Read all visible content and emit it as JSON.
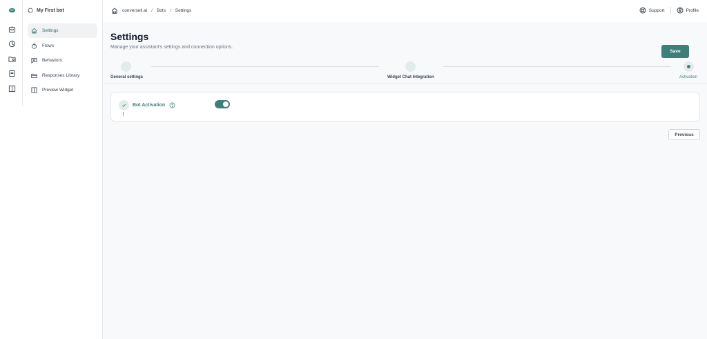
{
  "sidebar": {
    "bot_name": "My First bot",
    "items": [
      {
        "label": "Settings",
        "icon": "home-icon",
        "active": true
      },
      {
        "label": "Flows",
        "icon": "timer-icon"
      },
      {
        "label": "Behaviors",
        "icon": "message-square-icon"
      },
      {
        "label": "Responses Library",
        "icon": "folder-icon"
      },
      {
        "label": "Preview Widget",
        "icon": "columns-icon"
      }
    ]
  },
  "rail": {
    "icons": [
      "logo-icon",
      "bot-icon",
      "analytics-icon",
      "folder-settings-icon",
      "book-icon",
      "columns-icon"
    ]
  },
  "header": {
    "breadcrumb": [
      "conversell.ai",
      "Bots",
      "Settings"
    ],
    "separator": "/",
    "support_label": "Support",
    "profile_label": "Profile"
  },
  "page": {
    "title": "Settings",
    "subtitle": "Manage your assistant's settings and connection options.",
    "save_label": "Save",
    "previous_label": "Previous"
  },
  "steps": [
    {
      "label": "General settings",
      "state": "done"
    },
    {
      "label": "Widget Chat Integration",
      "state": "done"
    },
    {
      "label": "Activation",
      "state": "current"
    }
  ],
  "activation": {
    "label": "Bot Activation",
    "enabled": true
  },
  "colors": {
    "accent": "#3f7f79",
    "accent_light": "#e3ecea",
    "background": "#f8f9fb"
  }
}
